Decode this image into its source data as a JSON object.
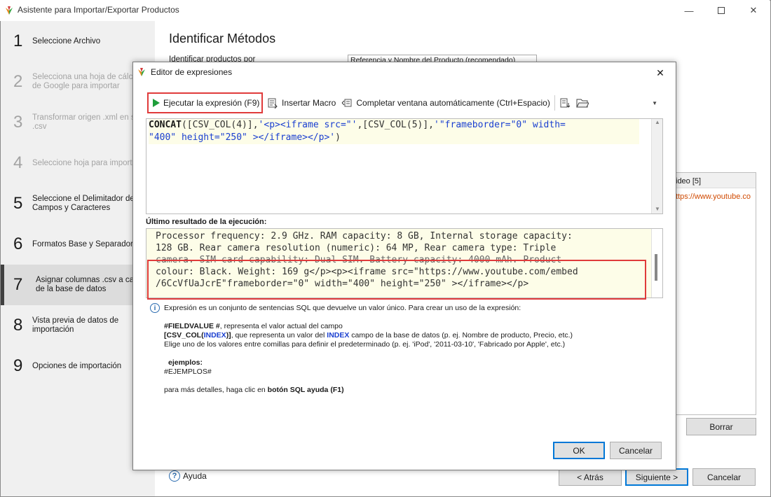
{
  "window": {
    "title": "Asistente para Importar/Exportar Productos"
  },
  "sidebar": {
    "steps": [
      {
        "num": "1",
        "label": "Seleccione Archivo"
      },
      {
        "num": "2",
        "label": "Selecciona una hoja de cálcu\nde Google para importar"
      },
      {
        "num": "3",
        "label": "Transformar origen .xml en s\n.csv"
      },
      {
        "num": "4",
        "label": "Seleccione hoja para importa"
      },
      {
        "num": "5",
        "label": "Seleccione el Delimitador de\nCampos y Caracteres"
      },
      {
        "num": "6",
        "label": "Formatos Base y Separadores"
      },
      {
        "num": "7",
        "label": "Asignar columnas .csv a cam\nde la base de datos"
      },
      {
        "num": "8",
        "label": "Vista previa de datos de\nimportación"
      },
      {
        "num": "9",
        "label": "Opciones de importación"
      }
    ]
  },
  "main": {
    "title": "Identificar Métodos",
    "identify_label": "Identificar productos por",
    "identify_value": "Referencia y Nombre del Producto (recomendado)",
    "right_panel_header": "ideo [5]",
    "right_panel_cell": "ttps://www.youtube.co",
    "borrar_label": "Borrar",
    "help_label": "Ayuda",
    "back_label": "< Atrás",
    "next_label": "Siguiente >",
    "cancel_label": "Cancelar"
  },
  "dialog": {
    "title": "Editor de expresiones",
    "toolbar": {
      "run_label": "Ejecutar la expresión (F9)",
      "macro_label": "Insertar Macro",
      "autocomplete_label": "Completar ventana automáticamente (Ctrl+Espacio)"
    },
    "expression": {
      "fn": "CONCAT",
      "part1": "([CSV_COL(4)],",
      "str1": "'<p><iframe src=\"'",
      "part2": ",[CSV_COL(5)],",
      "str2": "'\"frameborder=\"0\" width=",
      "line2": "\"400\" height=\"250\" ></iframe></p>'",
      "line2_end": ")"
    },
    "result_label": "Último resultado de la ejecución:",
    "result_lines": [
      "Processor frequency: 2.9 GHz. RAM capacity: 8 GB, Internal storage capacity:",
      "128 GB. Rear camera resolution (numeric): 64 MP, Rear camera type: Triple",
      "camera. SIM card capability: Dual SIM. Battery capacity: 4000 mAh. Product",
      "colour: Black. Weight: 169 g</p><p><iframe src=\"https://www.youtube.com/embed",
      "/6CcVfUaJcrE\"frameborder=\"0\" width=\"400\" height=\"250\" ></iframe></p>"
    ],
    "info": {
      "intro": "Expresión es un conjunto de sentencias SQL que devuelve un valor único. Para crear un uso de la expresión:",
      "fieldvalue_token": "#FIELDVALUE #",
      "fieldvalue_desc": ", representa el valor actual del campo",
      "csvcol_open": "[CSV_COL(",
      "csvcol_index": "INDEX",
      "csvcol_close": ")]",
      "csvcol_desc1": ", que representa un valor del ",
      "csvcol_index2": "INDEX",
      "csvcol_desc2": " campo de la base de datos (p. ej. Nombre de producto, Precio, etc.)",
      "quote_line": "Elige uno de los valores entre comillas para definir el predeterminado (p. ej. 'iPod', '2011-03-10', 'Fabricado por Apple', etc.)",
      "examples_label": "ejemplos:",
      "examples_token": "#EJEMPLOS#",
      "details_prefix": "para más detalles, haga clic en ",
      "details_bold": "botón SQL ayuda (F1)"
    },
    "ok_label": "OK",
    "cancel_label": "Cancelar"
  },
  "colors": {
    "highlight": "#e03b3b",
    "accent": "#0078d7",
    "string": "#1a3fd0",
    "editor_bg": "#fdfde8"
  }
}
